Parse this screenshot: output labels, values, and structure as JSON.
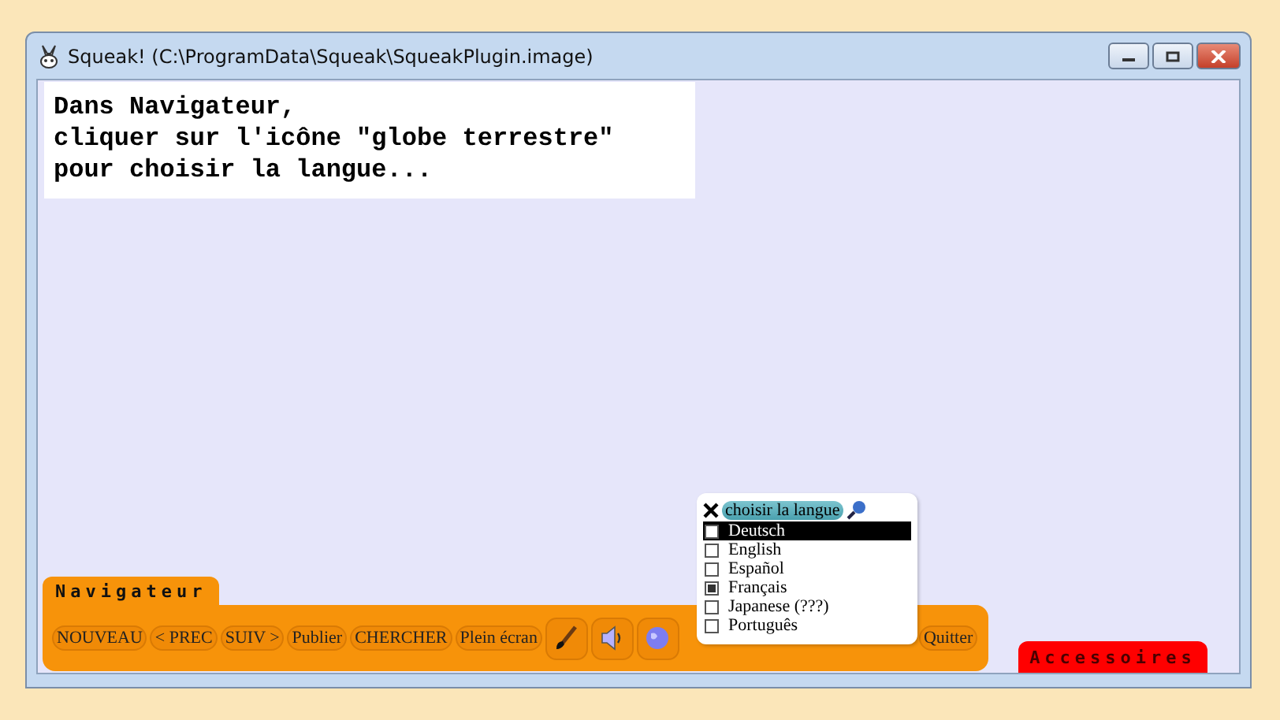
{
  "window": {
    "title": "Squeak! (C:\\ProgramData\\Squeak\\SqueakPlugin.image)"
  },
  "note": {
    "lines": [
      "Dans Navigateur,",
      "cliquer sur l'icône \"globe terrestre\"",
      "pour choisir la langue..."
    ]
  },
  "navigator": {
    "tab": "Navigateur",
    "buttons": [
      {
        "kind": "text",
        "label": "NOUVEAU"
      },
      {
        "kind": "text",
        "label": "< PREC"
      },
      {
        "kind": "text",
        "label": "SUIV >"
      },
      {
        "kind": "text",
        "label": "Publier"
      },
      {
        "kind": "text",
        "label": "CHERCHER"
      },
      {
        "kind": "text",
        "label": "Plein écran"
      },
      {
        "kind": "paint"
      },
      {
        "kind": "sound"
      },
      {
        "kind": "globe"
      },
      {
        "kind": "gap"
      },
      {
        "kind": "text",
        "label": "Quitter"
      }
    ]
  },
  "language_menu": {
    "title": "choisir la langue",
    "items": [
      {
        "label": "Deutsch",
        "selected": true,
        "checked": false
      },
      {
        "label": "English",
        "selected": false,
        "checked": false
      },
      {
        "label": "Español",
        "selected": false,
        "checked": false
      },
      {
        "label": "Français",
        "selected": false,
        "checked": true
      },
      {
        "label": "Japanese (???)",
        "selected": false,
        "checked": false
      },
      {
        "label": "Português",
        "selected": false,
        "checked": false
      }
    ]
  },
  "accessories_flap": {
    "tab": "Accessoires"
  }
}
